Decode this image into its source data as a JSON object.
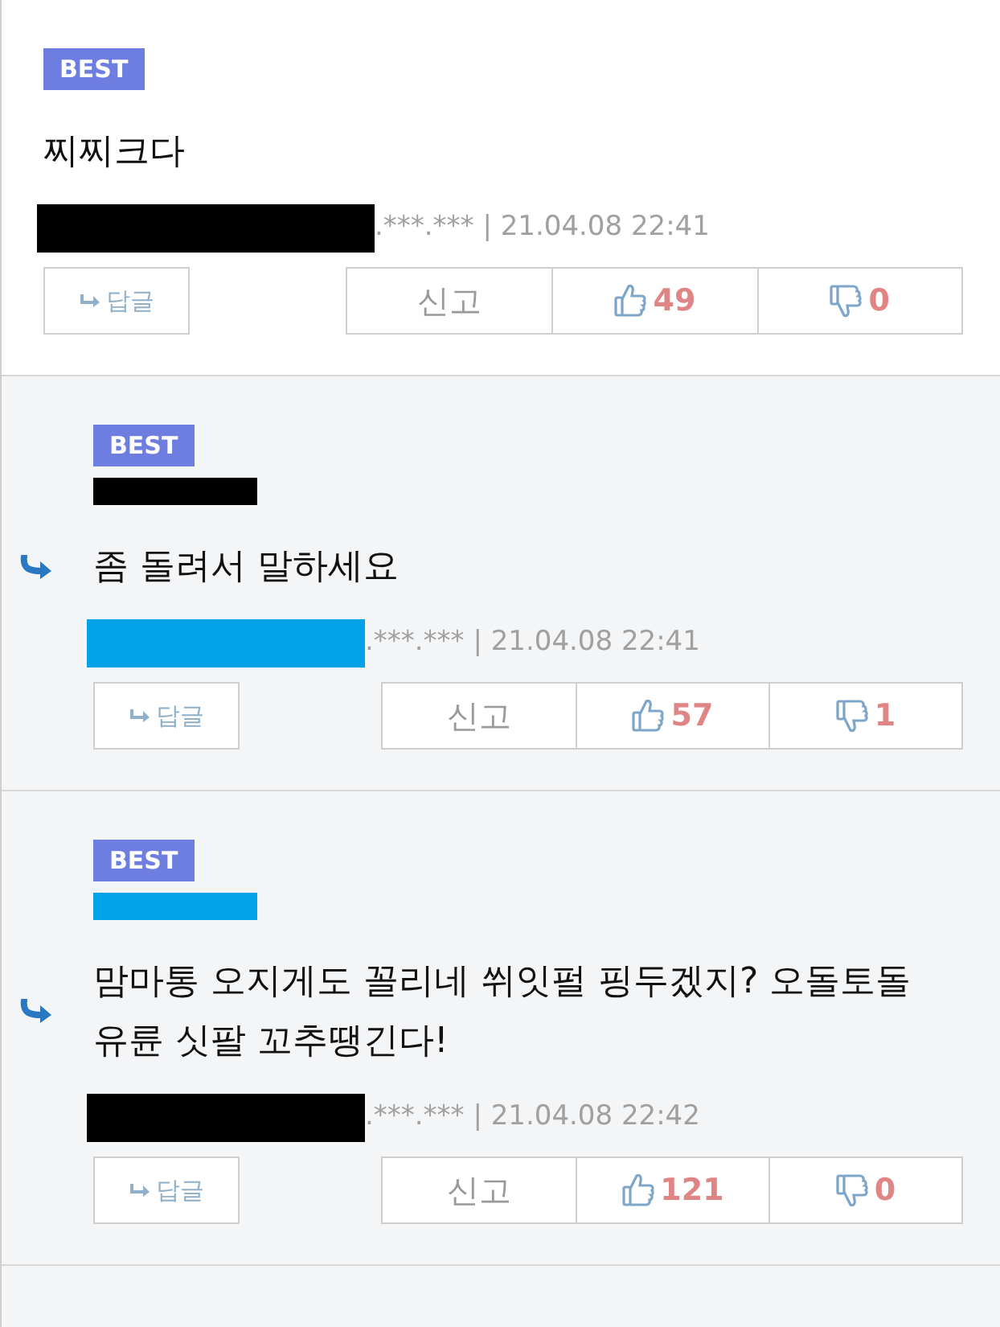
{
  "comments": [
    {
      "kind": "comment",
      "badge": "BEST",
      "text": "찌찌크다",
      "author_redaction": {
        "color": "#000000"
      },
      "meta": ".***.*** | 21.04.08 22:41",
      "reply_button": "답글",
      "report_button": "신고",
      "likes": "49",
      "dislikes": "0"
    },
    {
      "kind": "reply",
      "badge": "BEST",
      "name_redaction": {
        "color": "#000000"
      },
      "text": "좀 돌려서 말하세요",
      "author_redaction": {
        "color": "#00a2e8"
      },
      "meta": ".***.*** | 21.04.08 22:41",
      "reply_button": "답글",
      "report_button": "신고",
      "likes": "57",
      "dislikes": "1"
    },
    {
      "kind": "reply",
      "badge": "BEST",
      "name_redaction": {
        "color": "#00a2e8"
      },
      "text": "맘마통 오지게도 꼴리네 쒸잇펄 핑두겠지? 오돌토돌 유륜 싯팔 꼬추땡긴다!",
      "author_redaction": {
        "color": "#000000"
      },
      "meta": ".***.*** | 21.04.08 22:42",
      "reply_button": "답글",
      "report_button": "신고",
      "likes": "121",
      "dislikes": "0"
    }
  ]
}
